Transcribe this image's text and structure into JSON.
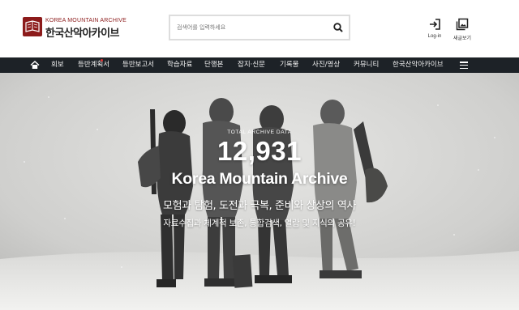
{
  "header": {
    "logo_en": "KOREA MOUNTAIN ARCHIVE",
    "logo_ko": "한국산악아카이브",
    "search_placeholder": "검색어를 입력하세요",
    "login_label": "Log-in",
    "subscribe_label": "새글보기"
  },
  "nav": {
    "items": [
      "회보",
      "등반계획서",
      "등반보고서",
      "학습자료",
      "단행본",
      "잡지·신문",
      "기록물",
      "사진/영상",
      "커뮤니티",
      "한국산악아카이브"
    ]
  },
  "hero": {
    "kicker": "TOTAL ARCHIVE DATA",
    "count": "12,931",
    "title": "Korea Mountain Archive",
    "subtitle": "모험과 탐험, 도전과 극복, 준비와 상상의 역사",
    "description": "자료수집과 체계적 보존, 통합검색, 열람 및 지식의 공유!"
  },
  "colors": {
    "brand": "#8c1b1b",
    "nav_bg": "#1d2227",
    "hero_text": "#ffffff"
  }
}
